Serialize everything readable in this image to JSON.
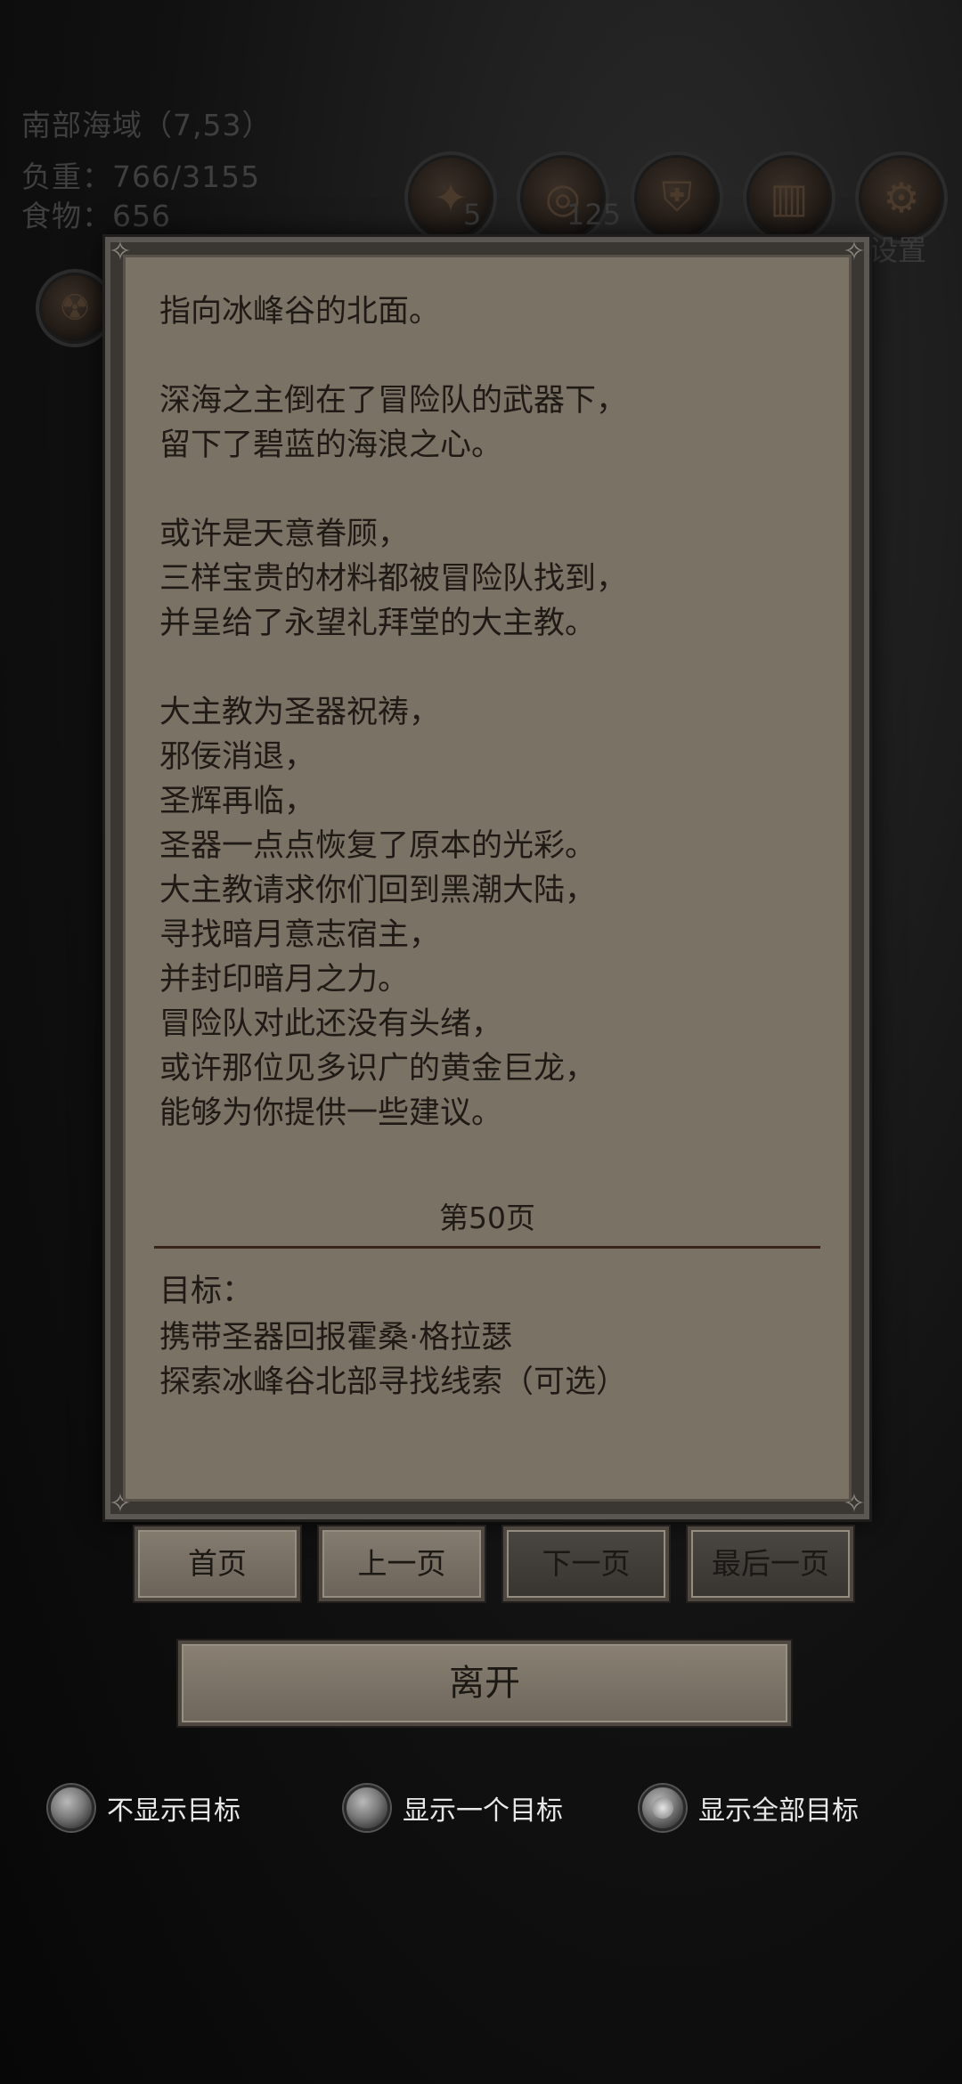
{
  "hud": {
    "location": "南部海域（7,53）",
    "load": "负重：766/3155",
    "food": "食物：656",
    "icon_badges": [
      "5",
      "125"
    ],
    "settings_label": "设置",
    "icons": [
      "torch-icon",
      "portal-icon",
      "shield-icon",
      "barrel-icon",
      "gear-icon"
    ]
  },
  "story": {
    "text": "指向冰峰谷的北面。\n\n深海之主倒在了冒险队的武器下，\n留下了碧蓝的海浪之心。\n\n或许是天意眷顾，\n三样宝贵的材料都被冒险队找到，\n并呈给了永望礼拜堂的大主教。\n\n大主教为圣器祝祷，\n邪佞消退，\n圣辉再临，\n圣器一点点恢复了原本的光彩。\n大主教请求你们回到黑潮大陆，\n寻找暗月意志宿主，\n并封印暗月之力。\n冒险队对此还没有头绪，\n或许那位见多识广的黄金巨龙，\n能够为你提供一些建议。",
    "page_label": "第50页"
  },
  "goals": {
    "label": "目标：",
    "items": [
      "携带圣器回报霍桑·格拉瑟",
      "探索冰峰谷北部寻找线索（可选）"
    ]
  },
  "buttons": {
    "first": "首页",
    "prev": "上一页",
    "next": "下一页",
    "last": "最后一页",
    "leave": "离开"
  },
  "options": {
    "hide": "不显示目标",
    "one": "显示一个目标",
    "all": "显示全部目标",
    "selected": "all"
  }
}
